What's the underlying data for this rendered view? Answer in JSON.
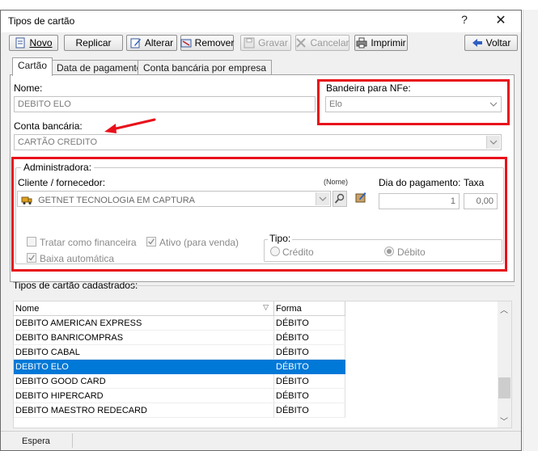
{
  "window": {
    "title": "Tipos de cartão",
    "help": "?",
    "close": "✕"
  },
  "background_app": {
    "fragment_1": "er",
    "fragment_2": "ã"
  },
  "toolbar": {
    "novo": "Novo",
    "replicar": "Replicar",
    "alterar": "Alterar",
    "remover": "Remover",
    "gravar": "Gravar",
    "cancelar": "Cancelar",
    "imprimir": "Imprimir",
    "voltar": "Voltar"
  },
  "tabs": [
    "Cartão",
    "Data de pagamento",
    "Conta bancária por empresa"
  ],
  "form": {
    "nome_label": "Nome:",
    "nome_value": "DEBITO ELO",
    "bandeira_label": "Bandeira para NFe:",
    "bandeira_value": "Elo",
    "conta_label": "Conta bancária:",
    "conta_value": "CARTÃO CREDITO",
    "administradora_label": "Administradora:",
    "cliente_label": "Cliente / fornecedor:",
    "nome_hint": "(Nome)",
    "cliente_value": "GETNET TECNOLOGIA EM CAPTURA",
    "dia_label": "Dia do pagamento:",
    "dia_value": "1",
    "taxa_label": "Taxa",
    "taxa_value": "0,00",
    "tratar_label": "Tratar como financeira",
    "tratar_checked": false,
    "ativo_label": "Ativo (para venda)",
    "ativo_checked": true,
    "baixa_label": "Baixa automática",
    "baixa_checked": true,
    "tipo_label": "Tipo:",
    "credito_label": "Crédito",
    "debito_label": "Débito",
    "tipo_selected": "Débito"
  },
  "list": {
    "section_label": "Tipos de cartão cadastrados:",
    "columns": [
      "Nome",
      "Forma"
    ],
    "rows": [
      {
        "nome": "DEBITO AMERICAN EXPRESS",
        "forma": "DÉBITO"
      },
      {
        "nome": "DEBITO BANRICOMPRAS",
        "forma": "DÉBITO"
      },
      {
        "nome": "DEBITO CABAL",
        "forma": "DÉBITO"
      },
      {
        "nome": "DEBITO ELO",
        "forma": "DÉBITO"
      },
      {
        "nome": "DEBITO GOOD CARD",
        "forma": "DÉBITO"
      },
      {
        "nome": "DEBITO HIPERCARD",
        "forma": "DÉBITO"
      },
      {
        "nome": "DEBITO MAESTRO REDECARD",
        "forma": "DÉBITO"
      }
    ],
    "selected_row": 3
  },
  "status": {
    "text": "Espera"
  },
  "colors": {
    "highlight_box": "#e8101a",
    "selection": "#0078d7"
  }
}
